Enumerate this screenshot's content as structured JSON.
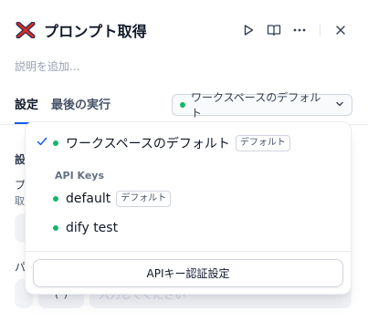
{
  "header": {
    "title": "プロンプト取得",
    "icon": "node-cross-icon",
    "description_placeholder": "説明を追加..."
  },
  "tabs": [
    {
      "label": "設定",
      "active": true
    },
    {
      "label": "最後の実行",
      "active": false
    }
  ],
  "workspace_select": {
    "value": "ワークスペースのデフォルト"
  },
  "background": {
    "settings_label": "設定",
    "prompt_label": "プロンプト",
    "prompt_sub": "取得",
    "input_placeholder": "...",
    "var_label": "パ",
    "small_box_text": "(*)",
    "input2_placeholder": "入力してください"
  },
  "dropdown": {
    "selected": {
      "label": "ワークスペースのデフォルト",
      "badge": "デフォルト"
    },
    "group_label": "API Keys",
    "keys": [
      {
        "label": "default",
        "badge": "デフォルト"
      },
      {
        "label": "dify test",
        "badge": ""
      }
    ],
    "action_label": "APIキー認証設定"
  },
  "colors": {
    "accent": "#155eef",
    "status_green": "#12b76a",
    "icon_red": "#d92d20",
    "icon_blue": "#1f2a5a"
  }
}
